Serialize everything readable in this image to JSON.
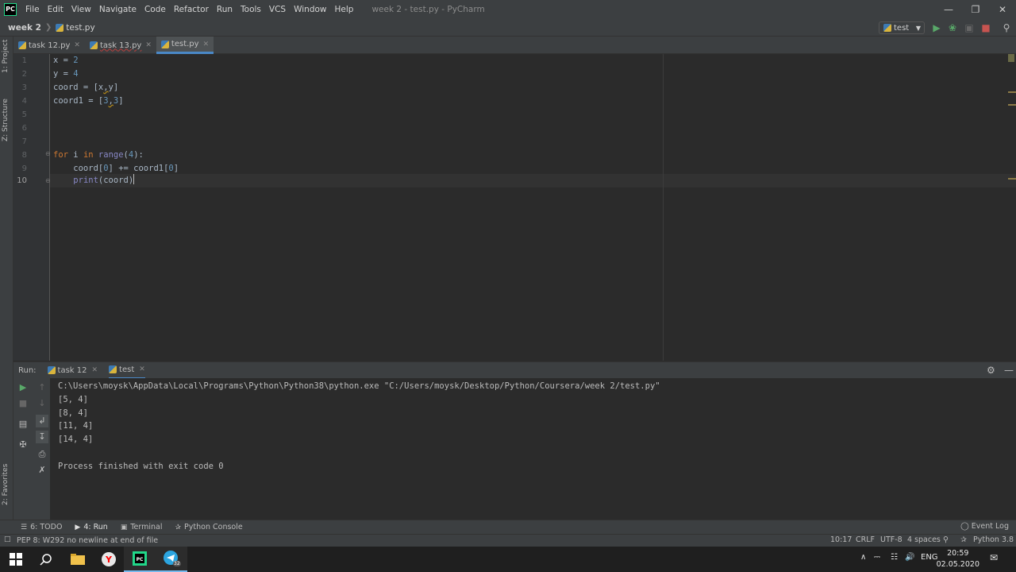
{
  "app": {
    "logo_text": "PC",
    "window_title": "week 2 - test.py - PyCharm",
    "menu": [
      "File",
      "Edit",
      "View",
      "Navigate",
      "Code",
      "Refactor",
      "Run",
      "Tools",
      "VCS",
      "Window",
      "Help"
    ]
  },
  "navbar": {
    "project": "week 2",
    "file": "test.py",
    "run_config": "test"
  },
  "tabs": [
    {
      "label": "task 12.py",
      "active": false,
      "has_error": false
    },
    {
      "label": "task 13.py",
      "active": false,
      "has_error": true
    },
    {
      "label": "test.py",
      "active": true,
      "has_error": false
    }
  ],
  "left_strip": {
    "project_label": "1: Project",
    "structure_label": "Z: Structure",
    "favorites_label": "2: Favorites"
  },
  "editor": {
    "line_numbers": [
      "1",
      "2",
      "3",
      "4",
      "5",
      "6",
      "7",
      "8",
      "9",
      "10"
    ],
    "current_line": "10",
    "lines": [
      "x = 2",
      "y = 4",
      "coord = [x,y]",
      "coord1 = [3,3]",
      "",
      "",
      "",
      "for i in range(4):",
      "    coord[0] += coord1[0]",
      "    print(coord)"
    ]
  },
  "run_panel": {
    "label": "Run:",
    "tabs": [
      "task 12",
      "test"
    ],
    "console": [
      "C:\\Users\\moysk\\AppData\\Local\\Programs\\Python\\Python38\\python.exe \"C:/Users/moysk/Desktop/Python/Coursera/week 2/test.py\"",
      "[5, 4]",
      "[8, 4]",
      "[11, 4]",
      "[14, 4]",
      "",
      "Process finished with exit code 0"
    ]
  },
  "bottom_tools": {
    "todo": "6: TODO",
    "run": "4: Run",
    "terminal": "Terminal",
    "python_console": "Python Console",
    "event_log": "Event Log"
  },
  "status": {
    "message": "PEP 8: W292 no newline at end of file",
    "position": "10:17",
    "line_sep": "CRLF",
    "encoding": "UTF-8",
    "indent": "4 spaces",
    "interpreter": "Python 3.8"
  },
  "taskbar": {
    "language": "ENG",
    "time": "20:59",
    "date": "02.05.2020",
    "telegram_badge": "32"
  },
  "colors": {
    "background": "#2b2b2b",
    "panel": "#3c3f41",
    "keyword": "#cc7832",
    "number": "#6897bb",
    "builtin": "#8888c6",
    "accent": "#4a88c7"
  }
}
